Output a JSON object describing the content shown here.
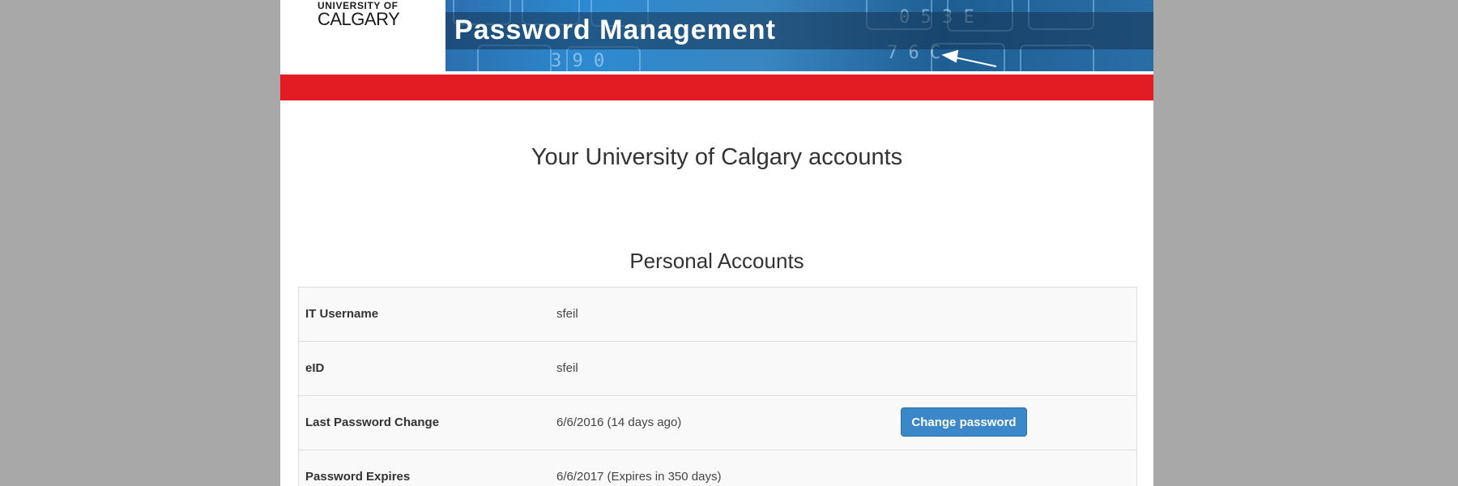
{
  "header": {
    "logo": {
      "line1": "UNIVERSITY OF",
      "line2": "CALGARY"
    },
    "banner_title": "Password Management"
  },
  "main": {
    "title": "Your University of Calgary accounts",
    "section_title": "Personal Accounts"
  },
  "accounts": {
    "rows": [
      {
        "label": "IT Username",
        "value": "sfeil"
      },
      {
        "label": "eID",
        "value": "sfeil"
      },
      {
        "label": "Last Password Change",
        "value": "6/6/2016 (14 days ago)",
        "action": "Change password"
      },
      {
        "label": "Password Expires",
        "value": "6/6/2017 (Expires in 350 days)"
      }
    ]
  },
  "colors": {
    "background": "#a8a8a8",
    "accent_red": "#e31b23",
    "button_blue": "#3a87c9"
  }
}
